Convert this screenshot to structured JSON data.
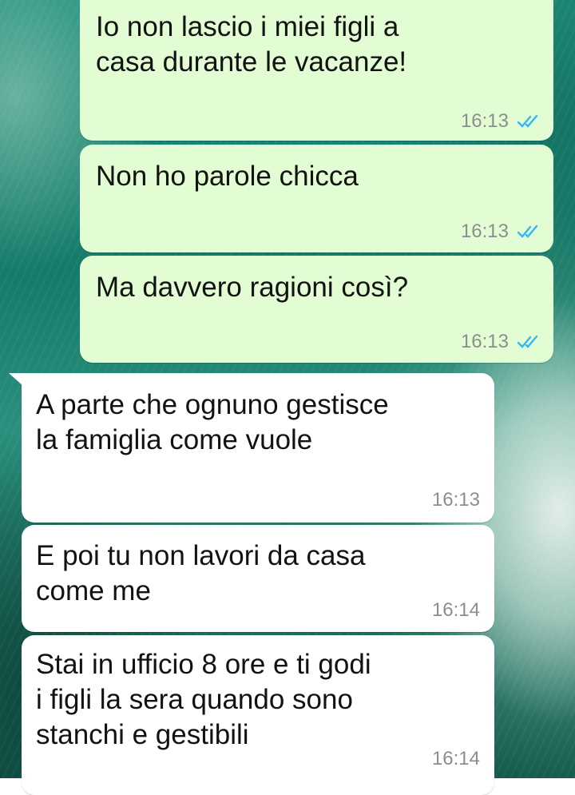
{
  "colors": {
    "outgoing_bubble": "#e2fcd4",
    "incoming_bubble": "#ffffff",
    "read_ticks": "#34b7f1",
    "timestamp": "#8a8f8c"
  },
  "messages": [
    {
      "direction": "outgoing",
      "text": "Io non lascio i miei figli a\ncasa durante le vacanze!",
      "time": "16:13",
      "status_icon": "double-check-read-icon"
    },
    {
      "direction": "outgoing",
      "text": "Non ho parole chicca",
      "time": "16:13",
      "status_icon": "double-check-read-icon"
    },
    {
      "direction": "outgoing",
      "text": "Ma davvero ragioni così?",
      "time": "16:13",
      "status_icon": "double-check-read-icon"
    },
    {
      "direction": "incoming",
      "text": "A parte che ognuno gestisce\nla famiglia come vuole",
      "time": "16:13"
    },
    {
      "direction": "incoming",
      "text": "E poi tu non lavori da casa\ncome me",
      "time": "16:14"
    },
    {
      "direction": "incoming",
      "text": "Stai in ufficio 8 ore e ti godi\ni figli la sera quando sono\nstanchi e gestibili",
      "time": "16:14"
    }
  ]
}
